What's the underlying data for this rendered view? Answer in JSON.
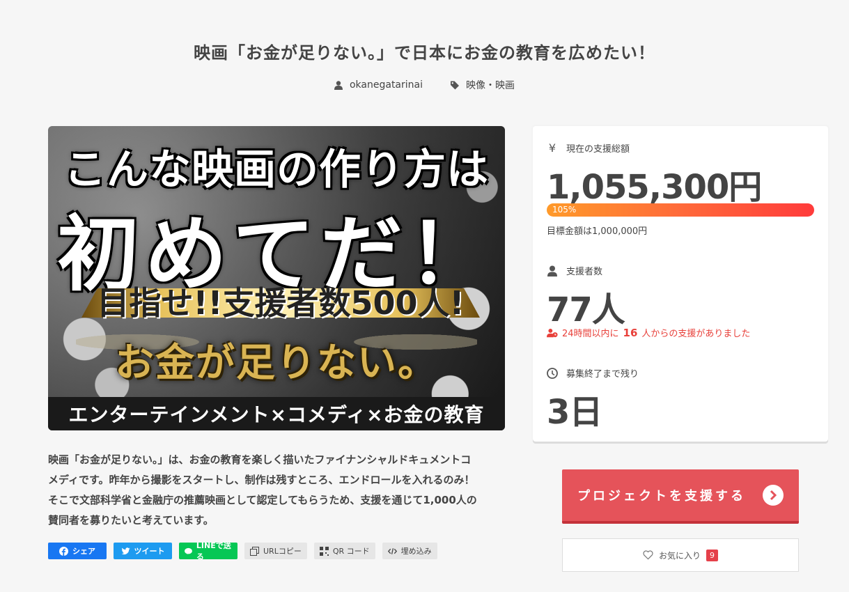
{
  "project": {
    "title": "映画「お金が足りない。」で日本にお金の教育を広めたい！",
    "author": "okanegatarinai",
    "category": "映像・映画"
  },
  "hero": {
    "line1": "こんな映画の作り方は",
    "line2": "初めてだ！",
    "ribbon": "目指せ!!支援者数500人!",
    "logo": "お金が足りない。",
    "bottom": "エンターテインメント×コメディ×お金の教育"
  },
  "description": {
    "lines": [
      "映画「お金が足りない。」は、お金の教育を楽しく描いたファイナンシャルドキュメントコ",
      "メディです。昨年から撮影をスタートし、制作は残すところ、エンドロールを入れるのみ！",
      "そこで文部科学省と金融庁の推薦映画として認定してもらうため、支援を通じて1,000人の",
      "賛同者を募りたいと考えています。"
    ]
  },
  "share": {
    "facebook": "シェア",
    "twitter": "ツイート",
    "line": "LINEで送る",
    "url_copy": "URLコピー",
    "qr": "QR コード",
    "embed": "埋め込み"
  },
  "stats": {
    "total_label": "現在の支援総額",
    "total_amount": "1,055,300円",
    "progress_percent": "105%",
    "progress_value": 1.05,
    "goal_text": "目標金額は1,000,000円",
    "supporters_label": "支援者数",
    "supporters_count": "77人",
    "recent_prefix": "24時間以内に",
    "recent_count": "16",
    "recent_suffix": "人からの支援がありました",
    "remaining_label": "募集終了まで残り",
    "remaining_value": "3日"
  },
  "actions": {
    "support_button": "プロジェクトを支援する",
    "favorite_label": "お気に入り",
    "favorite_count": "9"
  },
  "colors": {
    "accent": "#e5535a",
    "alert": "#e8403a",
    "facebook": "#1877f2",
    "twitter": "#1d9bf0",
    "line": "#06c755"
  }
}
